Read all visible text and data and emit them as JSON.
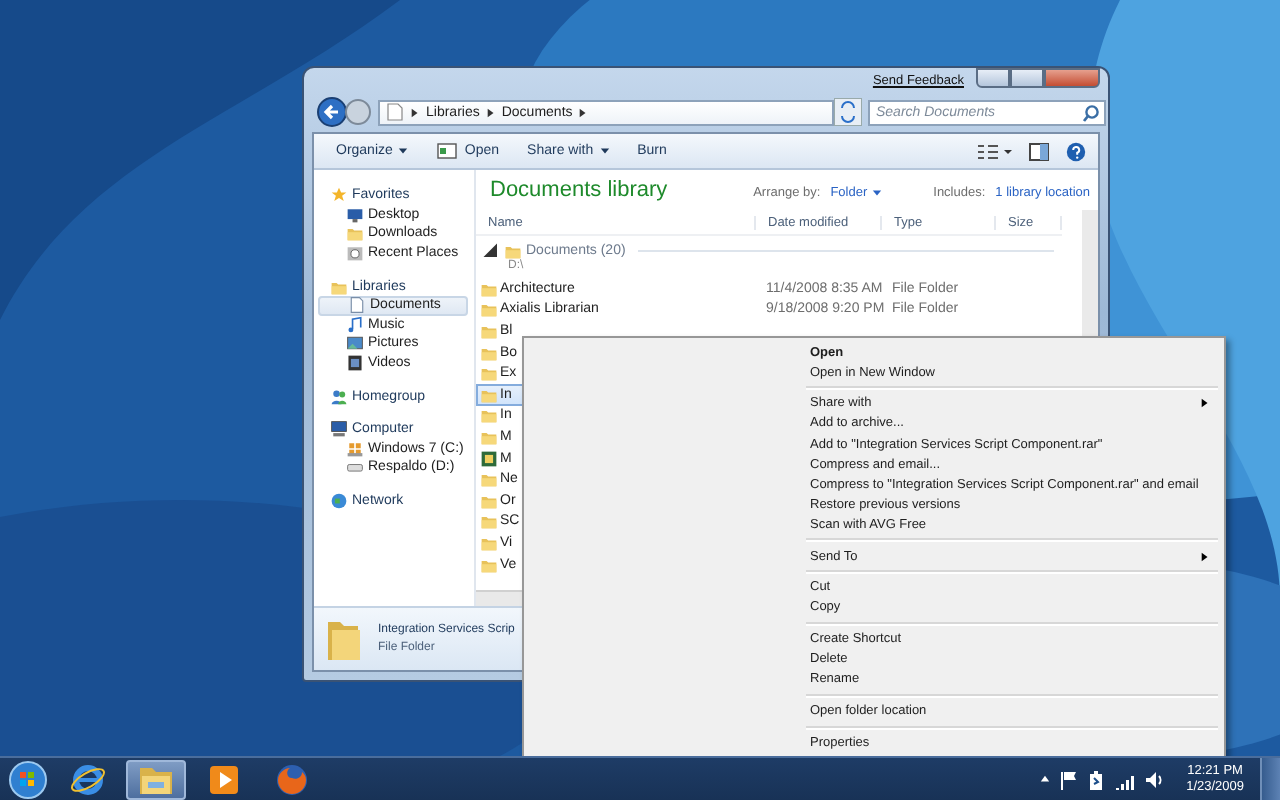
{
  "explorer": {
    "feedback_link": "Send Feedback",
    "address": {
      "path": [
        "Libraries",
        "Documents"
      ]
    },
    "search": {
      "placeholder": "Search Documents"
    },
    "toolbar": [
      {
        "label": "Organize",
        "dropdown": true
      },
      {
        "label": "Open",
        "dropdown": false
      },
      {
        "label": "Share with",
        "dropdown": true
      },
      {
        "label": "Burn",
        "dropdown": false
      }
    ],
    "sidebar": {
      "groups": [
        {
          "label": "Favorites",
          "selected": false,
          "children": [
            {
              "label": "Desktop",
              "selected": false
            },
            {
              "label": "Downloads",
              "selected": false
            },
            {
              "label": "Recent Places",
              "selected": false
            }
          ]
        },
        {
          "label": "Libraries",
          "selected": false,
          "children": [
            {
              "label": "Documents",
              "selected": true
            },
            {
              "label": "Music",
              "selected": false
            },
            {
              "label": "Pictures",
              "selected": false
            },
            {
              "label": "Videos",
              "selected": false
            }
          ]
        },
        {
          "label": "Homegroup",
          "selected": false
        },
        {
          "label": "Computer",
          "selected": false,
          "children": [
            {
              "label": "Windows 7 (C:)",
              "selected": false
            },
            {
              "label": "Respaldo (D:)",
              "selected": false
            }
          ]
        },
        {
          "label": "Network",
          "selected": false
        }
      ]
    },
    "library": {
      "title": "Documents library",
      "arrange_label": "Arrange by:",
      "arrange_value": "Folder",
      "includes_label": "Includes:",
      "includes_link": "1 library location"
    },
    "columns": [
      "Name",
      "Date modified",
      "Type",
      "Size"
    ],
    "group": {
      "title": "Documents (20)",
      "path": "D:\\",
      "expanded": true
    },
    "rows": [
      {
        "name": "Architecture",
        "date": "11/4/2008 8:35 AM",
        "type": "File Folder",
        "kind": "folder",
        "selected": false
      },
      {
        "name": "Axialis Librarian",
        "date": "9/18/2008 9:20 PM",
        "type": "File Folder",
        "kind": "folder",
        "selected": false
      },
      {
        "name": "Bl",
        "kind": "folder",
        "selected": false
      },
      {
        "name": "Bo",
        "kind": "folder",
        "selected": false
      },
      {
        "name": "Ex",
        "kind": "folder",
        "selected": false
      },
      {
        "name": "In",
        "kind": "folder",
        "selected": true
      },
      {
        "name": "In",
        "kind": "folder",
        "selected": false
      },
      {
        "name": "M",
        "kind": "folder",
        "selected": false
      },
      {
        "name": "M",
        "kind": "app",
        "selected": false
      },
      {
        "name": "Ne",
        "kind": "folder",
        "selected": false
      },
      {
        "name": "Or",
        "kind": "folder",
        "selected": false
      },
      {
        "name": "SC",
        "kind": "folder",
        "selected": false
      },
      {
        "name": "Vi",
        "kind": "folder",
        "selected": false
      },
      {
        "name": "Ve",
        "kind": "folder",
        "selected": false
      }
    ],
    "details": {
      "name": "Integration Services Scrip",
      "type": "File Folder"
    }
  },
  "context_menu": [
    {
      "kind": "item",
      "label": "Open",
      "bold": true,
      "submenu": false
    },
    {
      "kind": "item",
      "label": "Open in New Window",
      "bold": false,
      "submenu": false
    },
    {
      "kind": "separator"
    },
    {
      "kind": "item",
      "label": "Share with",
      "bold": false,
      "submenu": true
    },
    {
      "kind": "item",
      "label": "Add to archive...",
      "bold": false,
      "submenu": false
    },
    {
      "kind": "item",
      "label": "Add to \"Integration Services Script Component.rar\"",
      "bold": false,
      "submenu": false
    },
    {
      "kind": "item",
      "label": "Compress and email...",
      "bold": false,
      "submenu": false
    },
    {
      "kind": "item",
      "label": "Compress to \"Integration Services Script Component.rar\" and email",
      "bold": false,
      "submenu": false
    },
    {
      "kind": "item",
      "label": "Restore previous versions",
      "bold": false,
      "submenu": false
    },
    {
      "kind": "item",
      "label": "Scan with AVG Free",
      "bold": false,
      "submenu": false
    },
    {
      "kind": "separator"
    },
    {
      "kind": "item",
      "label": "Send To",
      "bold": false,
      "submenu": true
    },
    {
      "kind": "separator"
    },
    {
      "kind": "item",
      "label": "Cut",
      "bold": false,
      "submenu": false
    },
    {
      "kind": "item",
      "label": "Copy",
      "bold": false,
      "submenu": false
    },
    {
      "kind": "separator"
    },
    {
      "kind": "item",
      "label": "Create Shortcut",
      "bold": false,
      "submenu": false
    },
    {
      "kind": "item",
      "label": "Delete",
      "bold": false,
      "submenu": false
    },
    {
      "kind": "item",
      "label": "Rename",
      "bold": false,
      "submenu": false
    },
    {
      "kind": "separator"
    },
    {
      "kind": "item",
      "label": "Open folder location",
      "bold": false,
      "submenu": false
    },
    {
      "kind": "separator"
    },
    {
      "kind": "item",
      "label": "Properties",
      "bold": false,
      "submenu": false
    }
  ],
  "taskbar": {
    "apps": [
      {
        "kind": "ie",
        "selected": false
      },
      {
        "kind": "explorer",
        "selected": true
      },
      {
        "kind": "media",
        "selected": false
      },
      {
        "kind": "firefox",
        "selected": false
      }
    ],
    "clock": {
      "time": "12:21 PM",
      "date": "1/23/2009"
    }
  }
}
